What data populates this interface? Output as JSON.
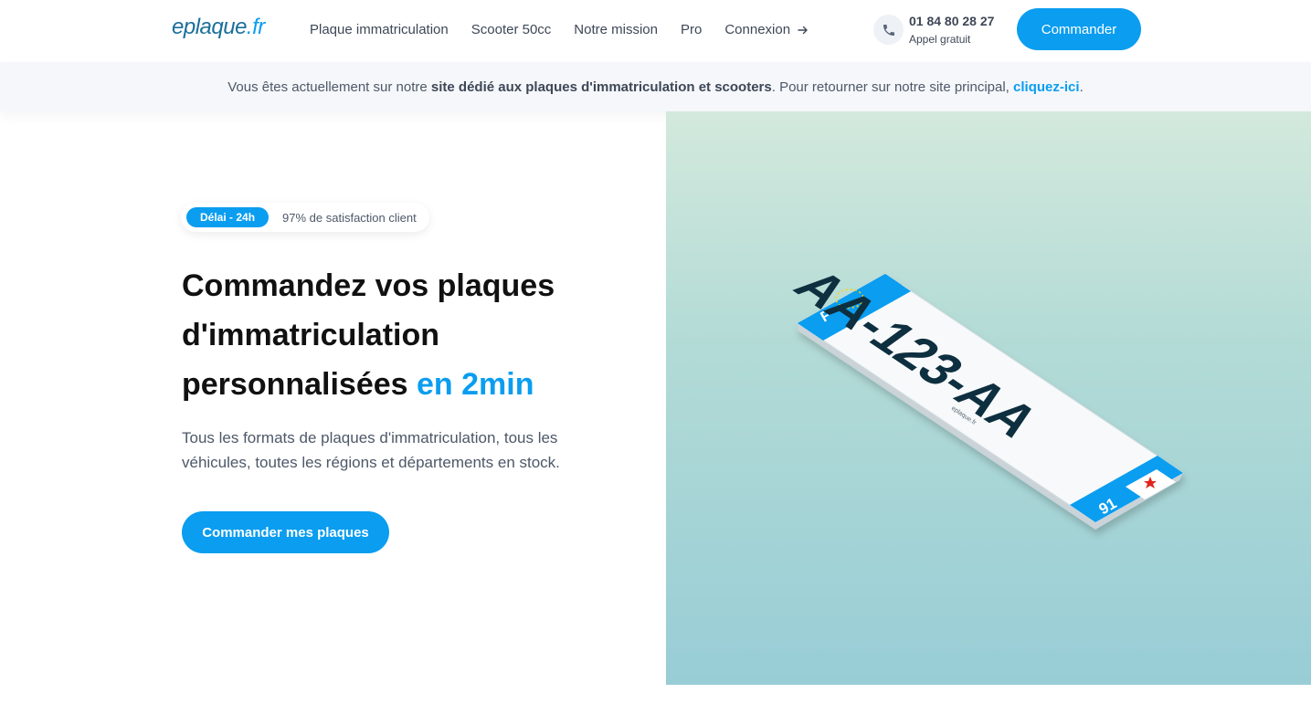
{
  "header": {
    "logo_part1": "eplaque",
    "logo_part2": ".fr",
    "nav": [
      "Plaque immatriculation",
      "Scooter 50cc",
      "Notre mission",
      "Pro",
      "Connexion"
    ],
    "phone_number": "01 84 80 28 27",
    "phone_label": "Appel gratuit",
    "cta_label": "Commander"
  },
  "infobar": {
    "prefix": "Vous êtes actuellement sur notre",
    "bold": "site dédié aux plaques d'immatriculation et scooters",
    "middle": ". Pour retourner sur notre site principal,",
    "link": "cliquez-ici",
    "suffix": "."
  },
  "hero": {
    "badge": "Délai - 24h",
    "badge_text": "97% de satisfaction client",
    "title_main": "Commandez vos plaques d'immatriculation personnalisées",
    "title_accent": "en 2min",
    "description": "Tous les formats de plaques d'immatriculation, tous les véhicules, toutes les régions et départements en stock.",
    "cta_label": "Commander mes plaques"
  },
  "plate": {
    "number": "AA-123-AA",
    "country": "F",
    "department": "91",
    "brand": "eplaque.fr"
  },
  "colors": {
    "accent": "#0a9df0",
    "text_dark": "#111111",
    "text_muted": "#4d5868"
  }
}
